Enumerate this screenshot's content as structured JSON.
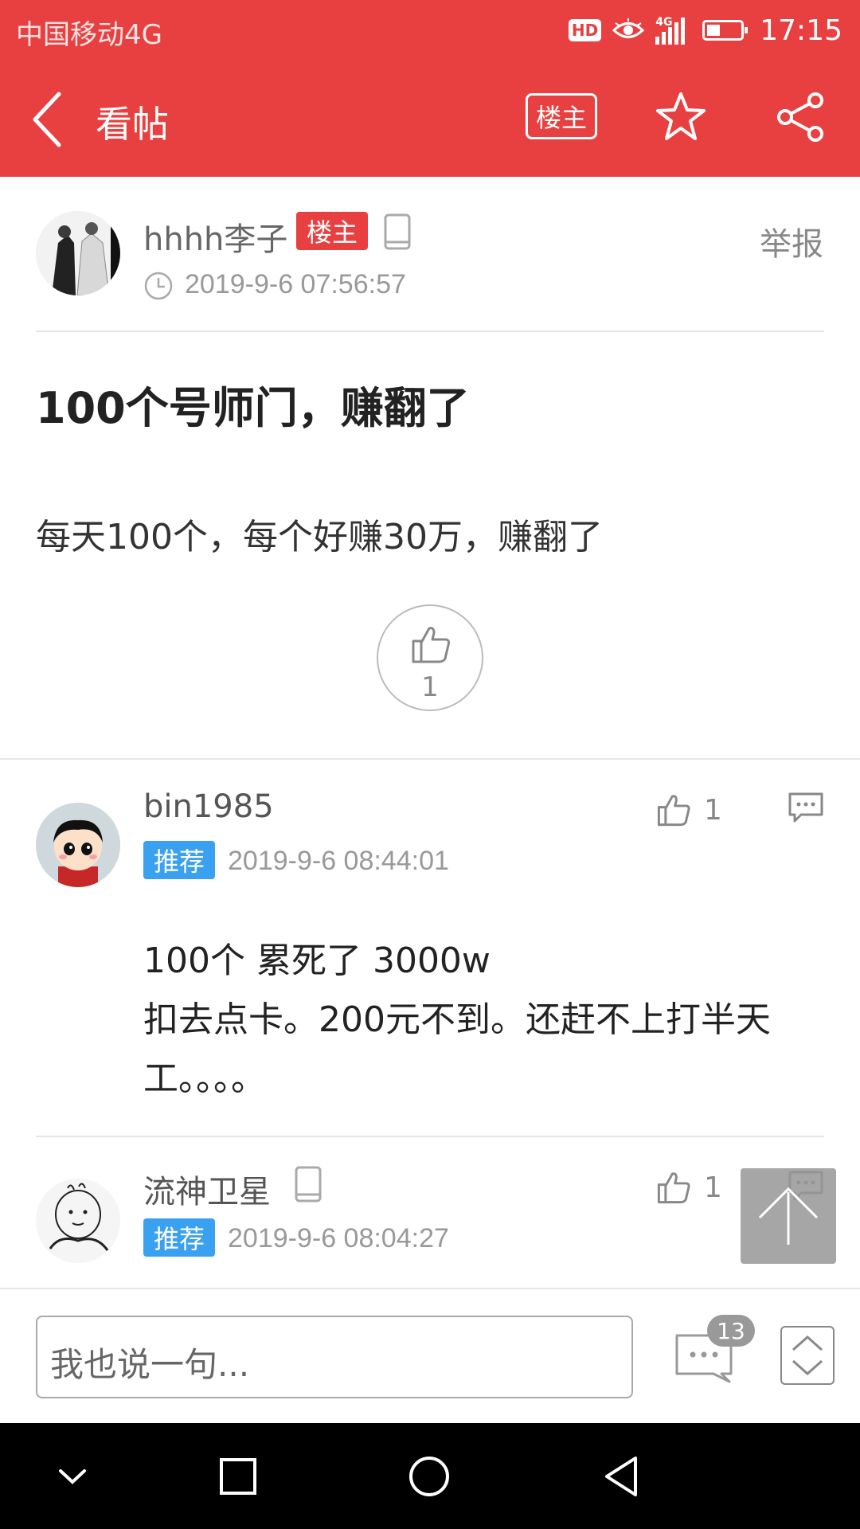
{
  "status_bar": {
    "carrier": "中国移动4G",
    "hd_badge": "HD",
    "network": "4G",
    "time": "17:15"
  },
  "app_bar": {
    "title": "看帖",
    "owner_button": "楼主",
    "icons": [
      "back-icon",
      "star-icon",
      "share-icon"
    ]
  },
  "post": {
    "author": "hhhh李子",
    "owner_tag": "楼主",
    "report": "举报",
    "time": "2019-9-6 07:56:57",
    "title": "100个号师门，赚翻了",
    "body": "每天100个，每个好赚30万，赚翻了",
    "likes": "1"
  },
  "comments": [
    {
      "author": "bin1985",
      "tag": "推荐",
      "time": "2019-9-6 08:44:01",
      "likes": "1",
      "lines": [
        "100个 累死了 3000w",
        "扣去点卡。200元不到。还赶不上打半天",
        "工。。。。"
      ]
    },
    {
      "author": "流神卫星",
      "tag": "推荐",
      "time": "2019-9-6 08:04:27",
      "likes": "1"
    }
  ],
  "input_bar": {
    "placeholder": "我也说一句...",
    "comment_count": "13"
  },
  "colors": {
    "brand_red": "#e84040",
    "recommend_blue": "#3aa0f0",
    "nav_black": "#000000"
  }
}
